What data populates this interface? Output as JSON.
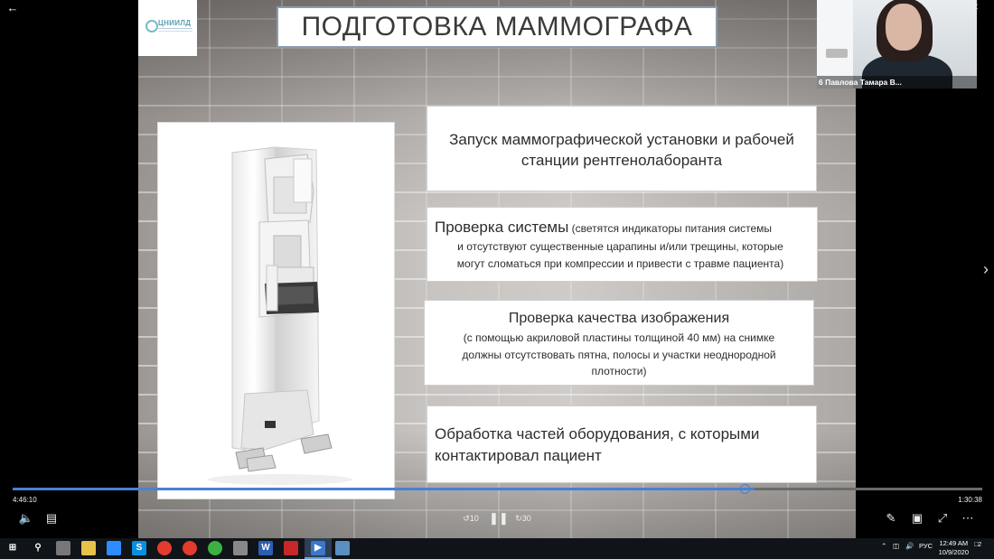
{
  "slide": {
    "logo_text": "ЦНИИЛД",
    "title": "ПОДГОТОВКА МАММОГРАФА",
    "box1": {
      "text_line1": "Запуск маммографической установки и рабочей",
      "text_line2": "станции рентгенолаборанта"
    },
    "box2": {
      "lead": "Проверка системы",
      "line1": " (светятся индикаторы  питания системы",
      "line2": "и  отсутствуют существенные царапины и/или трещины, которые",
      "line3": "могут сломаться при компрессии и привести с травме пациента)"
    },
    "box3": {
      "heading": "Проверка качества изображения",
      "line1": "(с помощью акриловой пластины толщиной 40 мм) на снимке",
      "line2": "должны отсутствовать пятна, полосы и участки неоднородной",
      "line3": "плотности)"
    },
    "box4": {
      "line1": "Обработка частей оборудования, с которыми",
      "line2": "контактировал пациент"
    }
  },
  "webcam": {
    "participant_name": "6 Павлова Тамара В..."
  },
  "player": {
    "current_time": "4:46:10",
    "total_time": "1:30:38",
    "progress": 0.765,
    "rewind_label": "10",
    "forward_label": "30"
  },
  "taskbar": {
    "language": "РУС",
    "time": "12:49 AM",
    "date": "10/9/2020",
    "notification_count": "2"
  },
  "colors": {
    "accent": "#4a7fd6",
    "title_border": "#8a9cb0",
    "taskbar": "#101418"
  }
}
